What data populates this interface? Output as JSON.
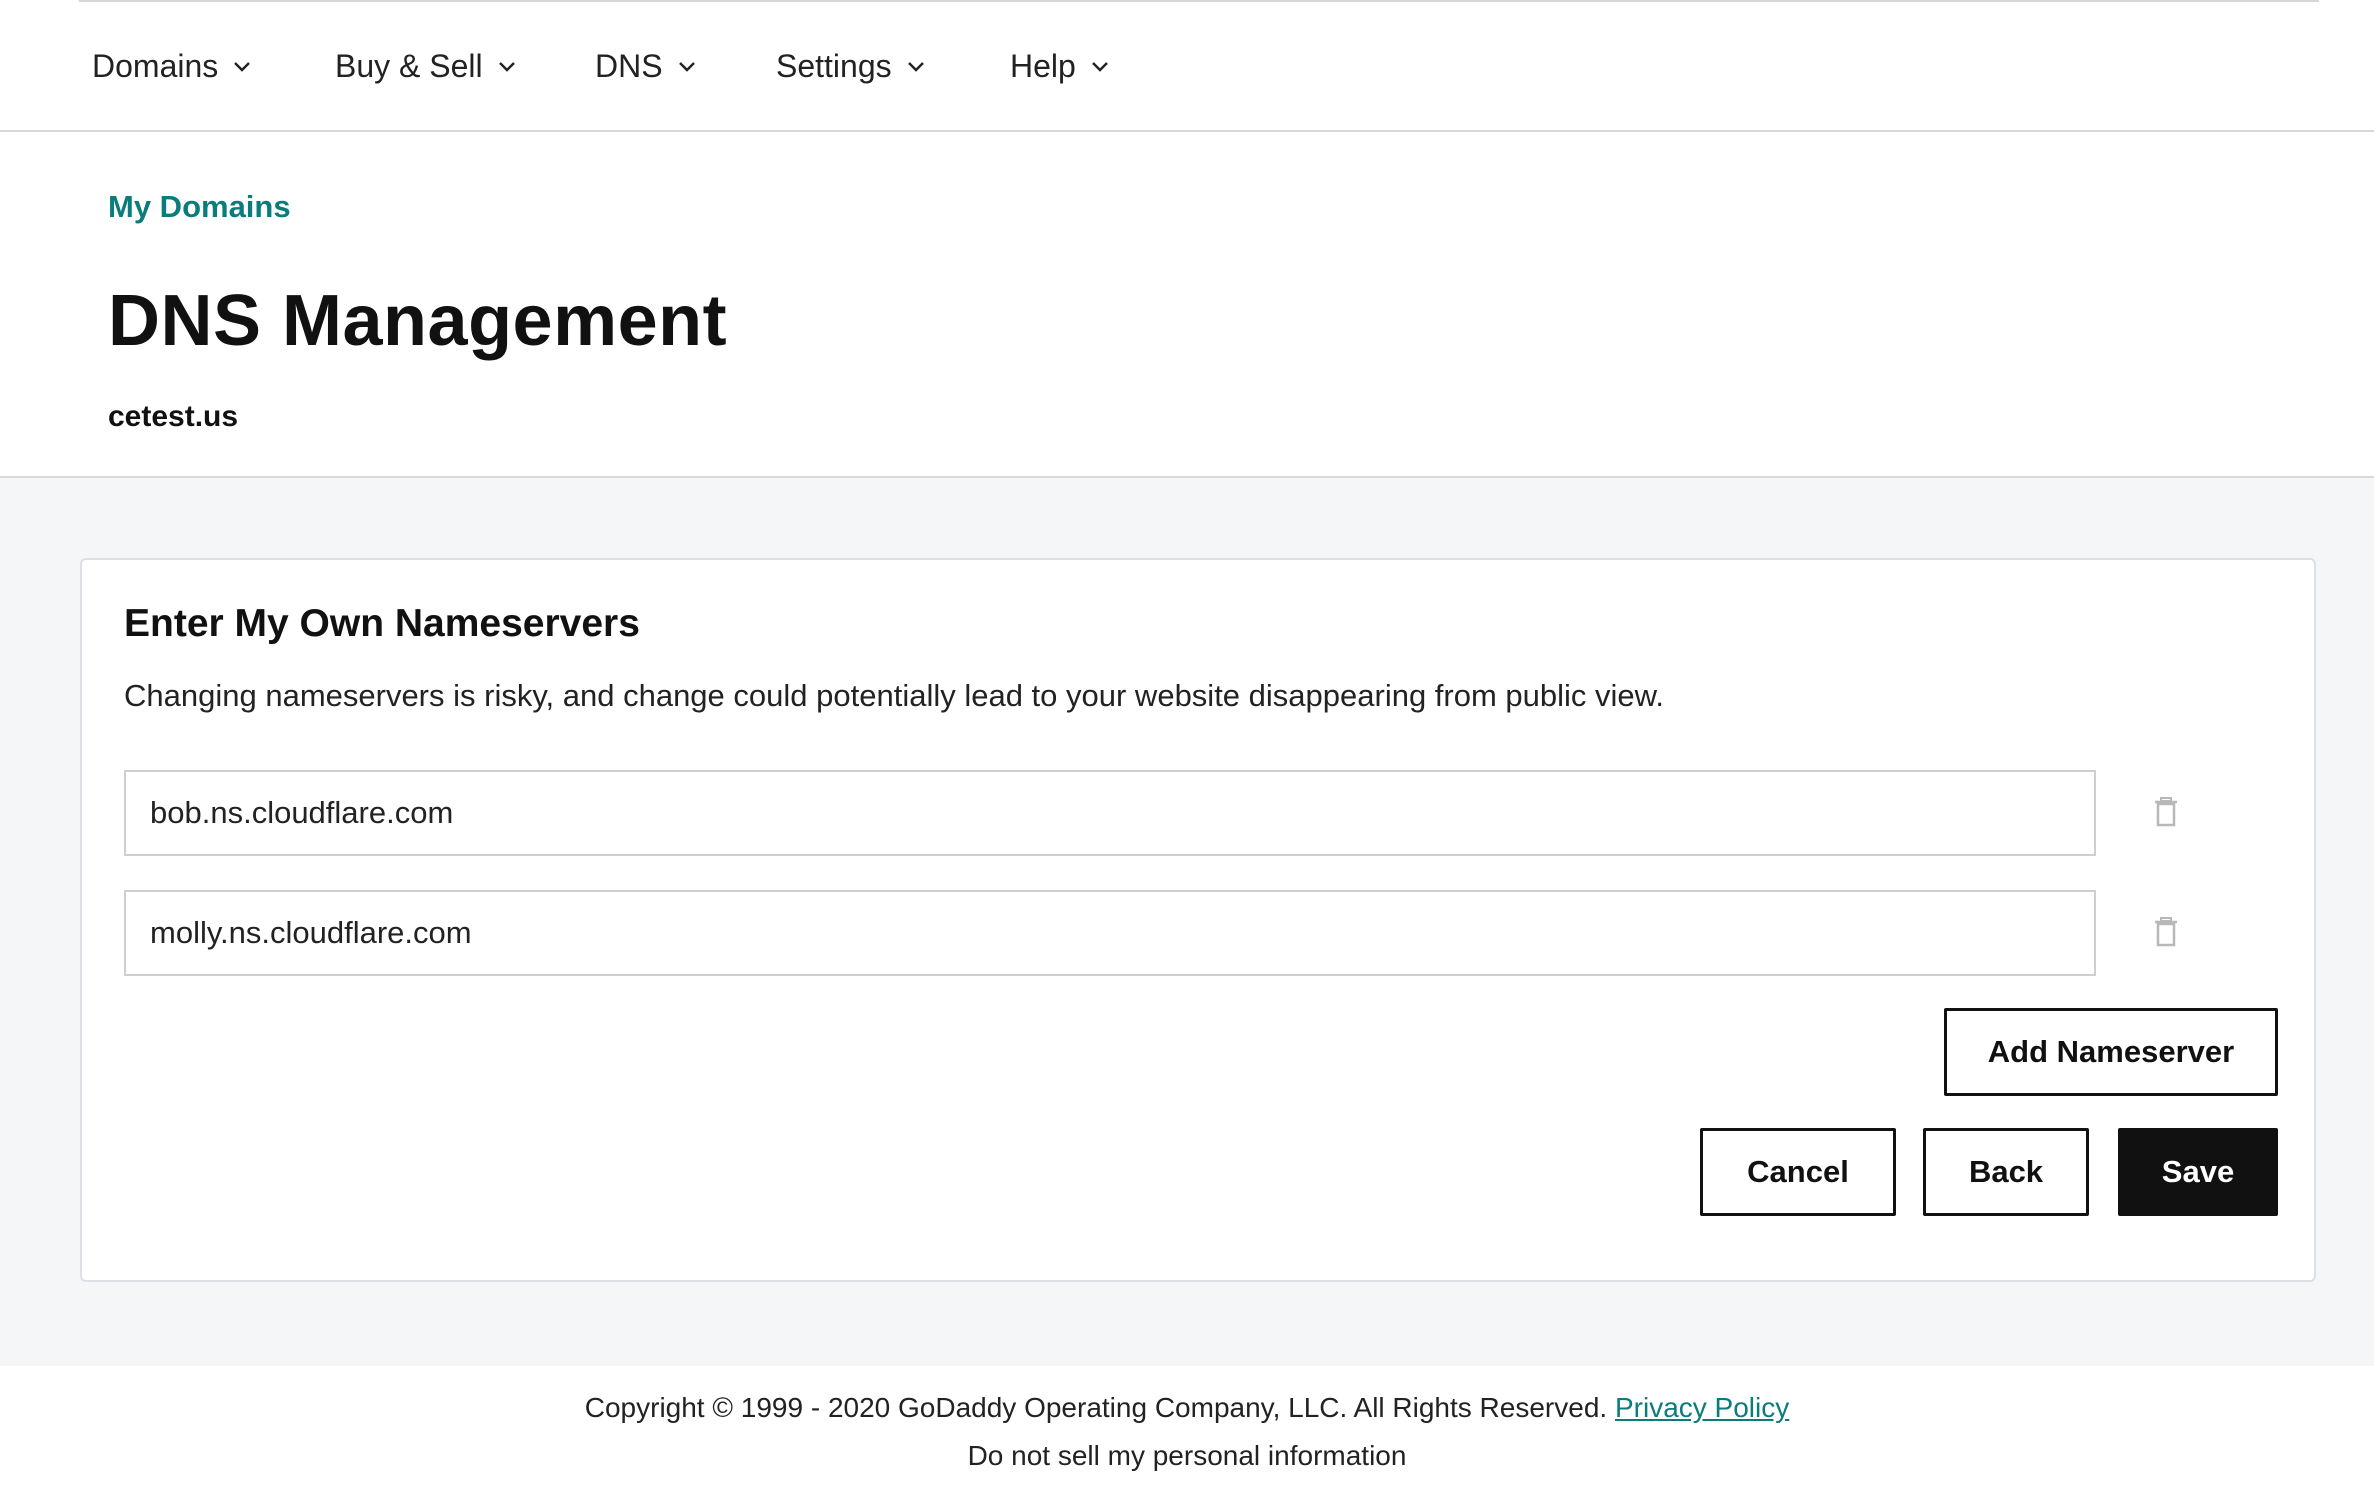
{
  "nav": {
    "items": [
      {
        "label": "Domains"
      },
      {
        "label": "Buy & Sell"
      },
      {
        "label": "DNS"
      },
      {
        "label": "Settings"
      },
      {
        "label": "Help"
      }
    ]
  },
  "header": {
    "breadcrumb": "My Domains",
    "title": "DNS Management",
    "domain": "cetest.us"
  },
  "card": {
    "title": "Enter My Own Nameservers",
    "description": "Changing nameservers is risky, and change could potentially lead to your website disappearing from public view.",
    "nameservers": [
      {
        "value": "bob.ns.cloudflare.com"
      },
      {
        "value": "molly.ns.cloudflare.com"
      }
    ],
    "add_button": "Add Nameserver",
    "cancel_button": "Cancel",
    "back_button": "Back",
    "save_button": "Save"
  },
  "footer": {
    "copyright": "Copyright © 1999 - 2020 GoDaddy Operating Company, LLC. All Rights Reserved.",
    "privacy_link": "Privacy Policy",
    "do_not_sell": "Do not sell my personal information"
  },
  "colors": {
    "link": "#0b7c7c",
    "primary_button": "#111111",
    "page_gray": "#f5f6f8"
  },
  "icons": [
    "chevron-down-icon",
    "trash-icon"
  ]
}
